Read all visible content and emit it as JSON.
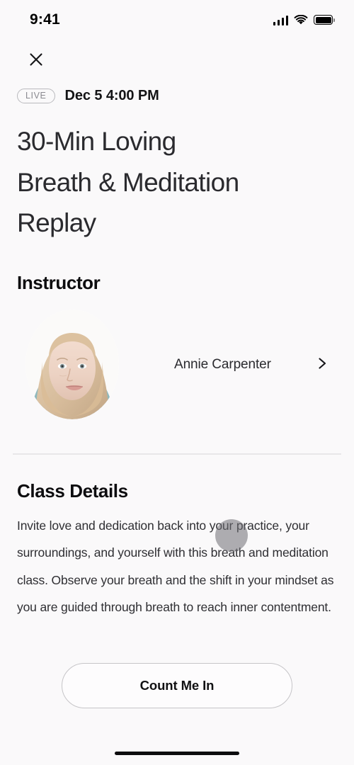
{
  "status_bar": {
    "time": "9:41",
    "cellular_icon": "cellular-signal-icon",
    "wifi_icon": "wifi-icon",
    "battery_icon": "battery-full-icon"
  },
  "nav": {
    "close_icon": "close-icon"
  },
  "meta": {
    "badge": "LIVE",
    "datetime": "Dec 5  4:00 PM"
  },
  "title": "30-Min Loving Breath & Meditation Replay",
  "instructor": {
    "heading": "Instructor",
    "name": "Annie Carpenter",
    "avatar_alt": "instructor-avatar",
    "chevron_icon": "chevron-right-icon"
  },
  "details": {
    "heading": "Class Details",
    "body": "Invite love and dedication back into your practice, your surroundings, and yourself with this breath and meditation class. Observe your breath and the shift in your mindset as you are guided through breath to reach inner contentment."
  },
  "cta": {
    "label": "Count Me In"
  },
  "colors": {
    "background": "#faf9fa",
    "text_primary": "#1b1b1d",
    "text_body": "#2f2f33",
    "badge_border": "#b9b9bd",
    "badge_text": "#8a8a90",
    "divider": "#e8e7e9",
    "button_border": "#c6c5c8",
    "tap_indicator": "rgba(110,110,115,0.55)"
  }
}
